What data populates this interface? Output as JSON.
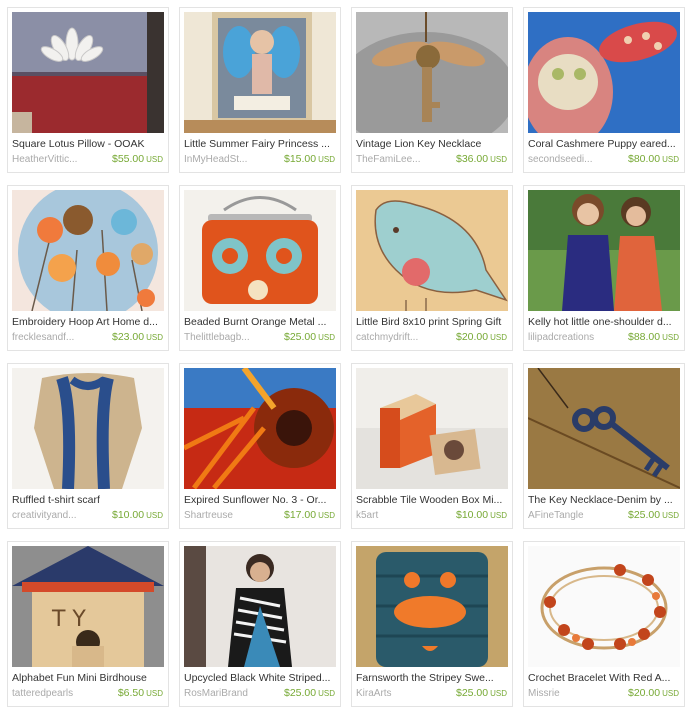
{
  "listings": [
    {
      "title": "Square Lotus Pillow - OOAK",
      "shop": "HeatherVittic...",
      "price": "$55.00",
      "currency": "USD",
      "image_icon": "lotus-pillow-image"
    },
    {
      "title": "Little Summer Fairy Princess ...",
      "shop": "InMyHeadSt...",
      "price": "$15.00",
      "currency": "USD",
      "image_icon": "fairy-collage-image"
    },
    {
      "title": "Vintage Lion Key Necklace",
      "shop": "TheFamiLee...",
      "price": "$36.00",
      "currency": "USD",
      "image_icon": "key-necklace-image"
    },
    {
      "title": "Coral Cashmere Puppy eared...",
      "shop": "secondseedi...",
      "price": "$80.00",
      "currency": "USD",
      "image_icon": "plush-puppy-image"
    },
    {
      "title": "Embroidery Hoop Art Home d...",
      "shop": "frecklesandf...",
      "price": "$23.00",
      "currency": "USD",
      "image_icon": "hoop-art-image"
    },
    {
      "title": "Beaded Burnt Orange Metal ...",
      "shop": "Thelittlebagb...",
      "price": "$25.00",
      "currency": "USD",
      "image_icon": "orange-purse-image"
    },
    {
      "title": "Little Bird 8x10 print Spring Gift",
      "shop": "catchmydrift...",
      "price": "$20.00",
      "currency": "USD",
      "image_icon": "bird-print-image"
    },
    {
      "title": "Kelly hot little one-shoulder d...",
      "shop": "lilipadcreations",
      "price": "$88.00",
      "currency": "USD",
      "image_icon": "dress-models-image"
    },
    {
      "title": "Ruffled t-shirt scarf",
      "shop": "creativityand...",
      "price": "$10.00",
      "currency": "USD",
      "image_icon": "blue-scarf-image"
    },
    {
      "title": "Expired Sunflower No. 3 - Or...",
      "shop": "Shartreuse",
      "price": "$17.00",
      "currency": "USD",
      "image_icon": "sunflower-photo-image"
    },
    {
      "title": "Scrabble Tile Wooden Box Mi...",
      "shop": "k5art",
      "price": "$10.00",
      "currency": "USD",
      "image_icon": "wooden-box-image"
    },
    {
      "title": "The Key Necklace-Denim by ...",
      "shop": "AFineTangle",
      "price": "$25.00",
      "currency": "USD",
      "image_icon": "denim-key-image"
    },
    {
      "title": "Alphabet Fun Mini Birdhouse",
      "shop": "tatteredpearls",
      "price": "$6.50",
      "currency": "USD",
      "image_icon": "birdhouse-image"
    },
    {
      "title": "Upcycled Black White Striped...",
      "shop": "RosMariBrand",
      "price": "$25.00",
      "currency": "USD",
      "image_icon": "striped-top-image"
    },
    {
      "title": "Farnsworth the Stripey Swe...",
      "shop": "KiraArts",
      "price": "$25.00",
      "currency": "USD",
      "image_icon": "sweater-monster-image"
    },
    {
      "title": "Crochet Bracelet With Red A...",
      "shop": "Missrie",
      "price": "$20.00",
      "currency": "USD",
      "image_icon": "crochet-bracelet-image"
    }
  ],
  "colors": {
    "price": "#77a935",
    "shop": "#aaaaaa",
    "title": "#333333",
    "border": "#e3e3e3"
  }
}
